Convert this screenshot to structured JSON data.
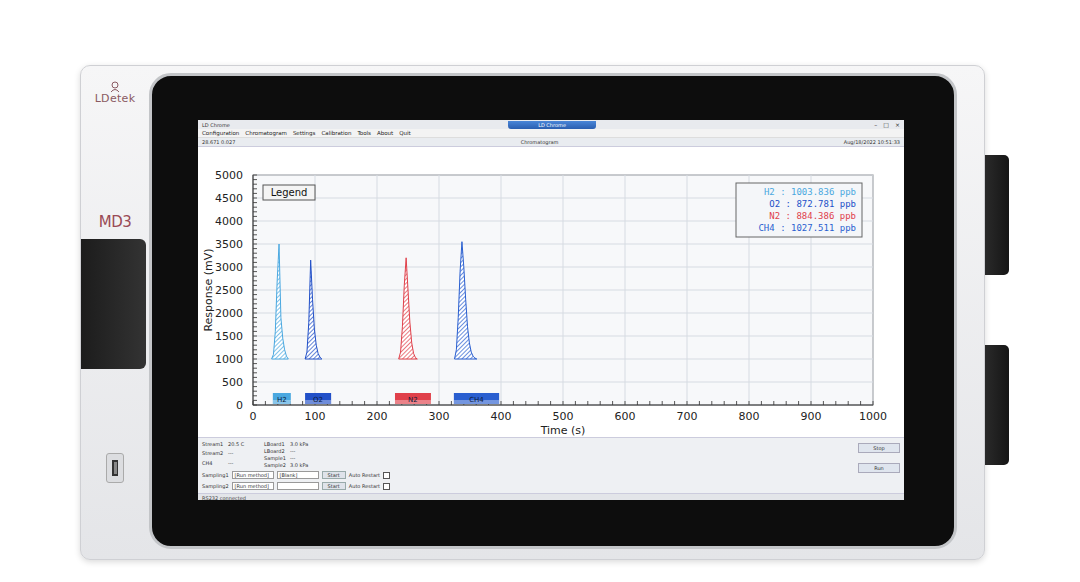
{
  "device": {
    "brand": "LDetek",
    "model": "MD3"
  },
  "window": {
    "title": "LD Chrome",
    "header": "Chromatogram",
    "info": "28.671 0.027",
    "datetime": "Aug/18/2022 10:51:33",
    "controls": [
      "–",
      "□",
      "×"
    ]
  },
  "menu": [
    "Configuration",
    "Chromatogram",
    "Settings",
    "Calibration",
    "Tools",
    "About",
    "Quit"
  ],
  "chart": {
    "y_label": "Response (mV)",
    "x_label": "Time (s)",
    "legend": "Legend",
    "y_ticks": [
      "0",
      "500",
      "1000",
      "1500",
      "2000",
      "2500",
      "3000",
      "3500",
      "4000",
      "4500",
      "5000"
    ],
    "x_ticks": [
      "0",
      "100",
      "200",
      "300",
      "400",
      "500",
      "600",
      "700",
      "800",
      "900",
      "1000"
    ],
    "series": [
      {
        "name": "H2",
        "reading": "H2 : 1003.836 ppb",
        "color": "#4aa8e0",
        "window": [
          32,
          61
        ],
        "times": [
          30,
          33,
          36,
          39,
          42,
          45,
          48,
          51,
          54,
          57
        ],
        "values": [
          1000,
          1100,
          1600,
          2700,
          3500,
          1900,
          1450,
          1200,
          1060,
          1000
        ]
      },
      {
        "name": "O2",
        "reading": "O2 : 872.781 ppb",
        "color": "#2250c8",
        "window": [
          84,
          126
        ],
        "times": [
          84,
          87,
          90,
          93,
          96,
          99,
          102,
          105,
          108,
          111
        ],
        "values": [
          1000,
          1150,
          1800,
          3150,
          2300,
          1650,
          1300,
          1120,
          1040,
          1000
        ]
      },
      {
        "name": "N2",
        "reading": "N2 : 884.386 ppb",
        "color": "#e0404a",
        "window": [
          229,
          287
        ],
        "times": [
          235,
          238,
          241,
          244,
          247,
          250,
          253,
          256,
          259,
          262,
          265
        ],
        "values": [
          1000,
          1150,
          1700,
          2600,
          3200,
          2500,
          1800,
          1350,
          1120,
          1030,
          1000
        ]
      },
      {
        "name": "CH4",
        "reading": "CH4 : 1027.511 ppb",
        "color": "#2a5fd0",
        "window": [
          324,
          397
        ],
        "times": [
          325,
          328,
          331,
          334,
          337,
          340,
          343,
          346,
          349,
          352,
          355,
          358,
          361
        ],
        "values": [
          1000,
          1200,
          1900,
          2900,
          3550,
          3000,
          2300,
          1700,
          1350,
          1150,
          1060,
          1020,
          1000
        ]
      }
    ]
  },
  "status": [
    {
      "name": "Stream1",
      "value": "20.5 C"
    },
    {
      "name": "Stream2",
      "value": "---"
    },
    {
      "name": "CH4",
      "value": "---"
    }
  ],
  "sensors": [
    {
      "name": "LBoard1",
      "value": "3.0 kPa"
    },
    {
      "name": "LBoard2",
      "value": "---"
    },
    {
      "name": "Sample1",
      "value": "---"
    },
    {
      "name": "Sample2",
      "value": "3.0 kPa"
    }
  ],
  "sampling": [
    {
      "label": "Sampling1",
      "method": "[Run method]",
      "stream": "[Blank]",
      "button": "Start",
      "auto_restart": "Auto Restart",
      "checked": false
    },
    {
      "label": "Sampling2",
      "method": "[Run method]",
      "stream": "",
      "button": "Start",
      "auto_restart": "Auto Restart",
      "checked": false
    }
  ],
  "buttons": [
    "Stop",
    "Run"
  ],
  "status_bar": "RS232 connected"
}
